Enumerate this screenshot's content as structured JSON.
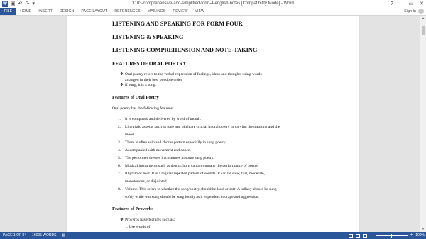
{
  "window": {
    "title": "3103-comprehensive-and-simplified-form-4-english-notes [Compatibility Mode] - Word",
    "app_icon_letter": "W",
    "help": "?",
    "minimize": "–",
    "restore": "▭",
    "close": "✕"
  },
  "qat": {
    "save": "▣",
    "undo": "↶",
    "redo": "↷",
    "customize": "▾"
  },
  "ribbon": {
    "tabs": [
      "FILE",
      "HOME",
      "INSERT",
      "DESIGN",
      "PAGE LAYOUT",
      "REFERENCES",
      "MAILINGS",
      "REVIEW",
      "VIEW"
    ],
    "signin": "Sign in"
  },
  "document": {
    "headings": [
      "LISTENING AND SPEAKING FOR FORM FOUR",
      "LISTENING & SPEAKING",
      "LISTENING COMPREHENSION AND NOTE-TAKING",
      "FEATURES OF ORAL POETRY"
    ],
    "intro_bullets": [
      "Oral poetry refers to the verbal expression of feelings, ideas and thoughts using words",
      "arranged in their best possible order.",
      "If sung, it is a song."
    ],
    "bullet_mark": "❖",
    "section1_title": "Features of Oral Poetry",
    "section1_lead": "Oral poetry has the following features:",
    "features": [
      {
        "num": "1.",
        "lines": [
          "It is composed and delivered by word of mouth."
        ]
      },
      {
        "num": "2.",
        "lines": [
          "Linguistic aspects such as tone and pitch are crucial in oral poetry in varying the meaning and the",
          "mood ."
        ]
      },
      {
        "num": "3.",
        "lines": [
          "There is often solo and chorus pattern especially in sung poetry."
        ]
      },
      {
        "num": "4.",
        "lines": [
          "Accompanied with movement and dance."
        ]
      },
      {
        "num": "5.",
        "lines": [
          "The performer dresses in costumes in some sung poetry."
        ]
      },
      {
        "num": "6.",
        "lines": [
          "Musical instruments such as drums, horn can accompany the performance of poetry."
        ]
      },
      {
        "num": "7.",
        "lines": [
          "Rhythm or beat. It is a regular repeated pattern of sounds. It can be slow, fast, moderate,",
          "monotonous, or disjointed."
        ]
      },
      {
        "num": "8.",
        "lines": [
          "Volume. This refers to whether the song/poetry should be loud or soft. A lullaby should be sung",
          "softly while war song should be sung loudly as it engenders courage and aggression."
        ]
      }
    ],
    "section2_title": "Features of Proverbs",
    "section2_bullet": "Proverbs have  features such as:",
    "cutoff_line": "1.   Use words of"
  },
  "status": {
    "page": "PAGE 1 OF 84",
    "words": "16605 WORDS",
    "zoom_minus": "–",
    "zoom_plus": "+",
    "zoom": "100%",
    "zoom_level_pct": 100
  },
  "colors": {
    "accent": "#2b579a"
  }
}
